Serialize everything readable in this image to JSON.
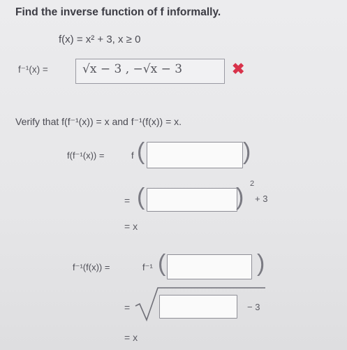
{
  "title": "Find the inverse function of f informally.",
  "function_def": "f(x) = x² + 3, x ≥ 0",
  "inverse_label": "f⁻¹(x) =",
  "inverse_answer": "√x − 3 , −√x − 3",
  "answer_status": "incorrect",
  "verify_text": "Verify that f(f⁻¹(x)) = x and f⁻¹(f(x)) = x.",
  "step1": {
    "label": "f(f⁻¹(x)) =",
    "open": "f",
    "exponent": "2",
    "suffix": "+ 3",
    "result": "= x"
  },
  "step2": {
    "label": "f⁻¹(f(x)) =",
    "open": "f⁻¹",
    "suffix": "− 3",
    "result": "= x"
  },
  "equals": "=",
  "icons": {
    "status": "x-mark-icon"
  },
  "colors": {
    "error": "#d8324a"
  }
}
